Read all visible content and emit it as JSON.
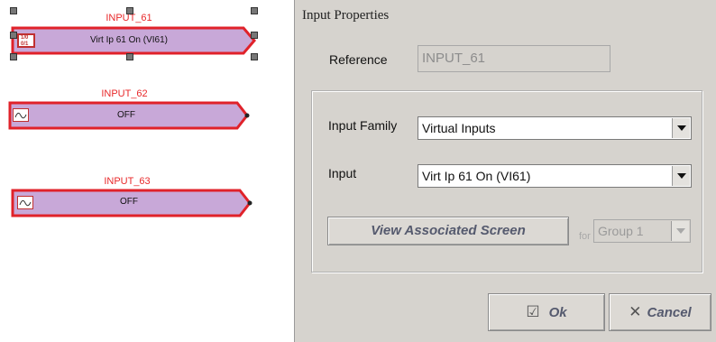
{
  "canvas": {
    "blocks": [
      {
        "title": "INPUT_61",
        "label": "Virt Ip 61 On (VI61)",
        "icon": "binary-input-icon",
        "selected": true
      },
      {
        "title": "INPUT_62",
        "label": "OFF",
        "icon": "waveform-icon",
        "selected": false
      },
      {
        "title": "INPUT_63",
        "label": "OFF",
        "icon": "waveform-icon",
        "selected": false
      }
    ],
    "icon_text": "1/0 0/1"
  },
  "dialog": {
    "title": "Input Properties",
    "reference_label": "Reference",
    "reference_value": "INPUT_61",
    "input_family_label": "Input Family",
    "input_family_value": "Virtual Inputs",
    "input_label": "Input",
    "input_value": "Virt Ip 61 On (VI61)",
    "view_screen_label": "View Associated Screen",
    "for_label": "for",
    "group_value": "Group 1",
    "ok_label": "Ok",
    "cancel_label": "Cancel"
  },
  "colors": {
    "block_fill": "#c8a8d8",
    "block_border": "#e0222a",
    "title_red": "#e8282a",
    "dialog_bg": "#d6d3ce"
  }
}
